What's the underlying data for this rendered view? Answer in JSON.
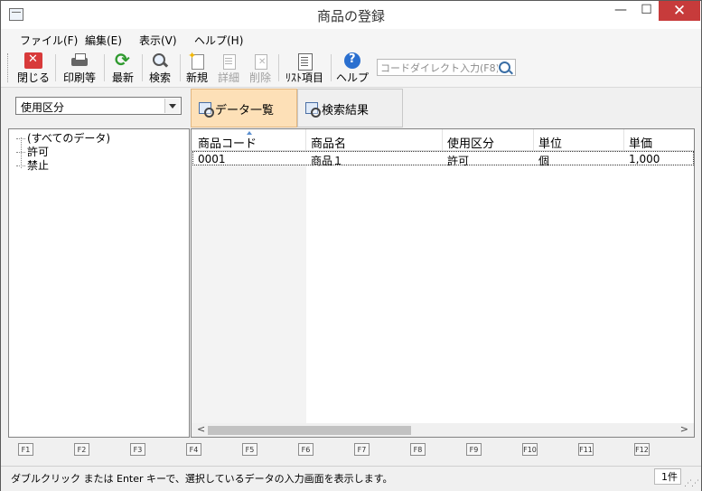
{
  "window": {
    "title": "商品の登録",
    "minimize": "—",
    "maximize": "☐",
    "close": "✕"
  },
  "menu": [
    {
      "label": "ファイル(F)"
    },
    {
      "label": "編集(E)"
    },
    {
      "label": "表示(V)"
    },
    {
      "label": "ヘルプ(H)"
    }
  ],
  "toolbar": {
    "close": "閉じる",
    "print": "印刷等",
    "refresh": "最新",
    "search": "検索",
    "new": "新規",
    "detail": "詳細",
    "delete": "削除",
    "list_items": "ﾘｽﾄ項目",
    "help": "ヘルプ",
    "code_input_placeholder": "コードダイレクト入力(F8)"
  },
  "filter": {
    "selected": "使用区分"
  },
  "tabs": [
    {
      "label": "データ一覧",
      "active": true
    },
    {
      "label": "検索結果",
      "active": false
    }
  ],
  "tree": [
    {
      "label": "(すべてのデータ)"
    },
    {
      "label": "許可"
    },
    {
      "label": "禁止"
    }
  ],
  "table": {
    "columns": [
      "商品コード",
      "商品名",
      "使用区分",
      "単位",
      "単価"
    ],
    "rows": [
      [
        "0001",
        "商品１",
        "許可",
        "個",
        "1,000"
      ]
    ]
  },
  "fkeys": [
    "F1",
    "F2",
    "F3",
    "F4",
    "F5",
    "F6",
    "F7",
    "F8",
    "F9",
    "F10",
    "F11",
    "F12"
  ],
  "status": {
    "message": "ダブルクリック または Enter キーで、選択しているデータの入力画面を表示します。",
    "count": "1件"
  },
  "colors": {
    "active_tab": "#fde0b7",
    "close_button": "#c73b3b"
  }
}
